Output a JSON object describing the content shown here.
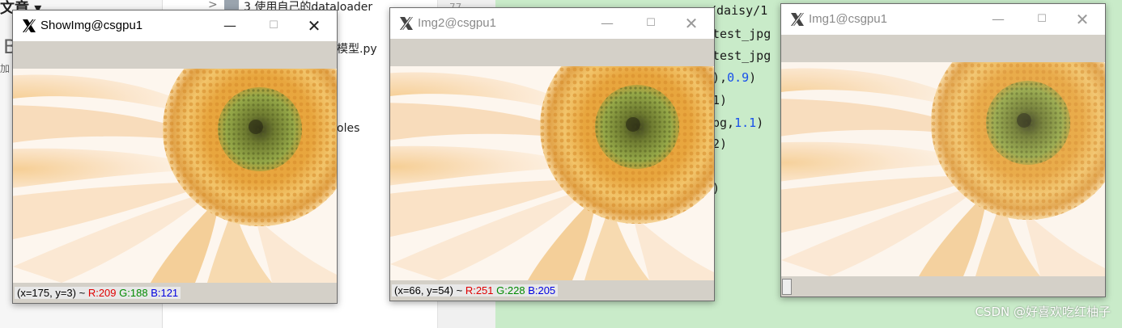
{
  "background": {
    "left_fragments": [
      "文章 ▾",
      "B",
      "加"
    ],
    "tree_item_folder": "3 使用自己的dataloader",
    "tree_item_file": "模型.py",
    "tree_item_other": "oles",
    "tree_chevron": ">",
    "gutter_text": "77",
    "code_lines": [
      {
        "text": "/daisy/1",
        "num": ""
      },
      {
        "text": "test_jpg",
        "num": ""
      },
      {
        "text": "test_jpg",
        "num": ""
      },
      {
        "text": "),",
        "num": "0.9"
      },
      {
        "text": "1)",
        "num": ""
      },
      {
        "text": "pg,",
        "num": "1.1"
      },
      {
        "text": "2)",
        "num": ""
      },
      {
        "text": ")",
        "num": ""
      }
    ]
  },
  "windows": [
    {
      "name": "showimg-window",
      "title": "ShowImg@csgpu1",
      "active": true,
      "status": {
        "coords": "(x=175, y=3) ~ ",
        "r": "R:209",
        "g": "G:188",
        "b": "B:121"
      }
    },
    {
      "name": "img2-window",
      "title": "Img2@csgpu1",
      "active": false,
      "status": {
        "coords": "(x=66, y=54) ~ ",
        "r": "R:251",
        "g": "G:228",
        "b": "B:205"
      }
    },
    {
      "name": "img1-window",
      "title": "Img1@csgpu1",
      "active": false,
      "status": null
    }
  ],
  "controls": {
    "minimize": "—",
    "maximize": "☐",
    "close": "✕"
  },
  "watermark": "CSDN @好喜欢吃红柚子"
}
